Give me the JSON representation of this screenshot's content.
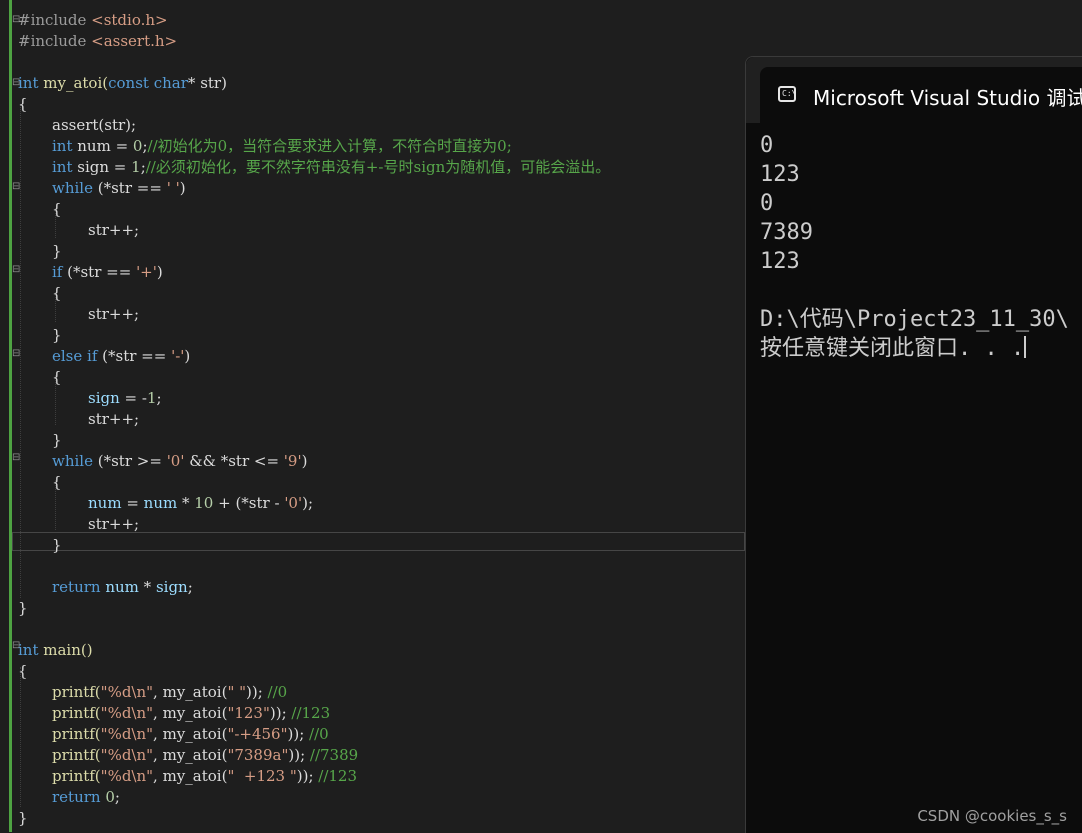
{
  "editor": {
    "lines": {
      "l1": [
        "#include ",
        "<stdio.h>"
      ],
      "l2": [
        "#include ",
        "<assert.h>"
      ],
      "l4": [
        "int",
        " my_atoi(",
        "const",
        " ",
        "char",
        "* str)"
      ],
      "l5": [
        "{"
      ],
      "l6": [
        "assert(str);"
      ],
      "l7": [
        "int",
        " num = ",
        "0",
        ";",
        "//初始化为0，当符合要求进入计算，不符合时直接为0;"
      ],
      "l8": [
        "int",
        " sign = ",
        "1",
        ";",
        "//必须初始化，要不然字符串没有+-号时sign为随机值，可能会溢出。"
      ],
      "l9": [
        "while",
        " (*str == ",
        "' '",
        ")"
      ],
      "l10": [
        "{"
      ],
      "l11": [
        "str++;"
      ],
      "l12": [
        "}"
      ],
      "l13": [
        "if",
        " (*str == ",
        "'+'",
        ")"
      ],
      "l14": [
        "{"
      ],
      "l15": [
        "str++;"
      ],
      "l16": [
        "}"
      ],
      "l17": [
        "else",
        " ",
        "if",
        " (*str == ",
        "'-'",
        ")"
      ],
      "l18": [
        "{"
      ],
      "l19": [
        "sign",
        " = -",
        "1",
        ";"
      ],
      "l20": [
        "str++;"
      ],
      "l21": [
        "}"
      ],
      "l22": [
        "while",
        " (*str >= ",
        "'0'",
        " && *str <= ",
        "'9'",
        ")"
      ],
      "l23": [
        "{"
      ],
      "l24": [
        "num",
        " = ",
        "num",
        " * ",
        "10",
        " + (*str - ",
        "'0'",
        ");"
      ],
      "l25": [
        "str++;"
      ],
      "l26": [
        "}"
      ],
      "l28": [
        "return",
        " ",
        "num",
        " * ",
        "sign",
        ";"
      ],
      "l29": [
        "}"
      ],
      "l31": [
        "int",
        " main()"
      ],
      "l32": [
        "{"
      ],
      "l33": [
        "printf(",
        "\"%d\\n\"",
        ", my_atoi(",
        "\" \"",
        ")); ",
        "//0"
      ],
      "l34": [
        "printf(",
        "\"%d\\n\"",
        ", my_atoi(",
        "\"123\"",
        ")); ",
        "//123"
      ],
      "l35": [
        "printf(",
        "\"%d\\n\"",
        ", my_atoi(",
        "\"-+456\"",
        ")); ",
        "//0"
      ],
      "l36": [
        "printf(",
        "\"%d\\n\"",
        ", my_atoi(",
        "\"7389a\"",
        ")); ",
        "//7389"
      ],
      "l37": [
        "printf(",
        "\"%d\\n\"",
        ", my_atoi(",
        "\"  +123 \"",
        ")); ",
        "//123"
      ],
      "l38": [
        "return",
        " ",
        "0",
        ";"
      ],
      "l39": [
        "}"
      ]
    },
    "fold_glyph": "⊟",
    "colors": {
      "keyword": "#569cd6",
      "string": "#d69d85",
      "comment": "#57a64a",
      "number": "#b5cea8",
      "variable": "#9cdcfe",
      "change_bar": "#4ea342"
    }
  },
  "console": {
    "icon": "cmd-icon",
    "icon_text": "C:\\",
    "title": "Microsoft Visual Studio 调试控制台",
    "output": [
      "0",
      "123",
      "0",
      "7389",
      "123",
      "",
      "D:\\代码\\Project23_11_30\\",
      "按任意键关闭此窗口. . ."
    ]
  },
  "watermark": "CSDN @cookies_s_s"
}
